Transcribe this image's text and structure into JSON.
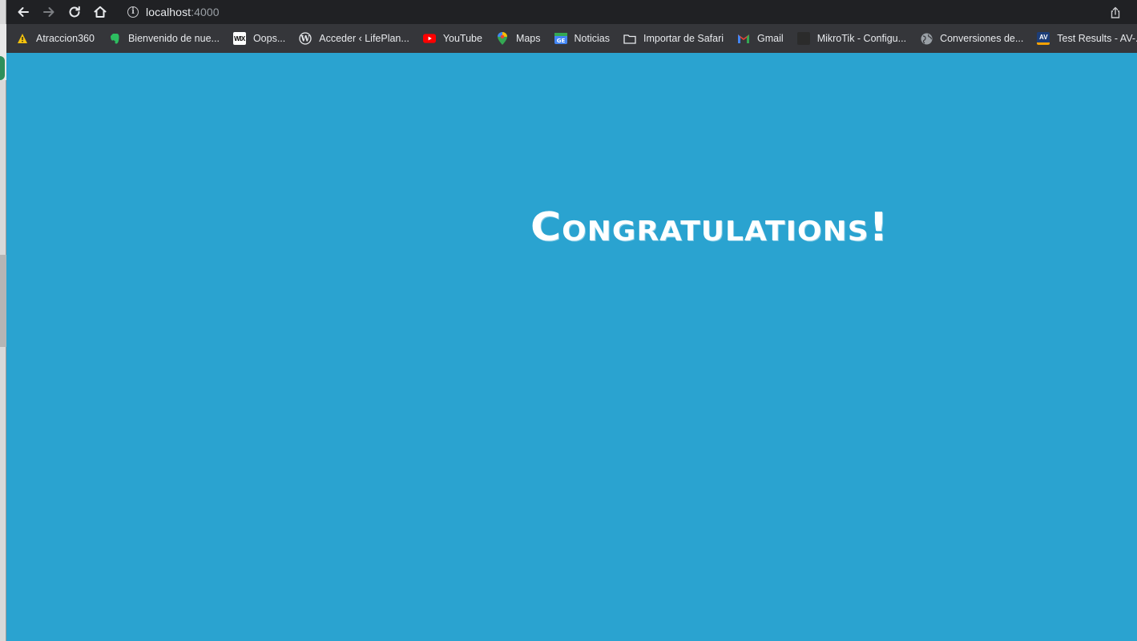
{
  "browser": {
    "url_host": "localhost",
    "url_port": ":4000",
    "bookmarks": [
      {
        "label": "Atraccion360",
        "icon": "warning-icon",
        "color": "#f4c20d"
      },
      {
        "label": "Bienvenido de nue...",
        "icon": "evernote-icon",
        "color": "#2dbe60"
      },
      {
        "label": "Oops...",
        "icon": "wix-icon",
        "color": "#ffffff"
      },
      {
        "label": "Acceder ‹ LifePlan...",
        "icon": "wordpress-icon",
        "color": "#ffffff"
      },
      {
        "label": "YouTube",
        "icon": "youtube-icon",
        "color": "#ff0000"
      },
      {
        "label": "Maps",
        "icon": "maps-pin-icon",
        "color": "#34a853"
      },
      {
        "label": "Noticias",
        "icon": "google-news-icon",
        "color": "#4285f4"
      },
      {
        "label": "Importar de Safari",
        "icon": "folder-icon",
        "color": "#e8eaed"
      },
      {
        "label": "Gmail",
        "icon": "gmail-icon",
        "color": "#ea4335"
      },
      {
        "label": "MikroTik - Configu...",
        "icon": "mikrotik-icon",
        "color": "#2b2b2b"
      },
      {
        "label": "Conversiones de...",
        "icon": "globe-icon",
        "color": "#9aa0a6"
      },
      {
        "label": "Test Results - AV-...",
        "icon": "av-test-icon",
        "color": "#1c3d78"
      }
    ]
  },
  "page": {
    "heading": "Congratulations!",
    "background": "#2aa3d0"
  }
}
